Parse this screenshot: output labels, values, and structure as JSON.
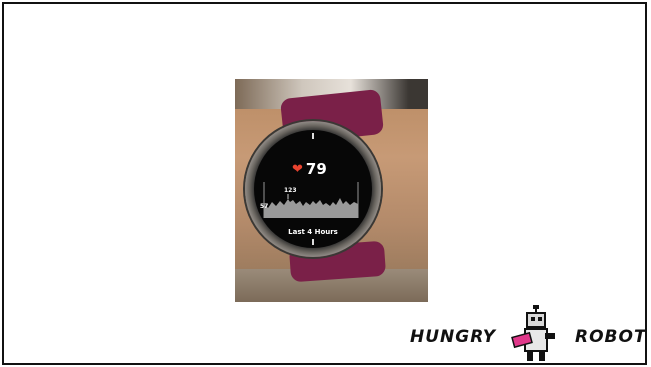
{
  "watch": {
    "heart_rate": "79",
    "chart_max": "123",
    "chart_min": "57",
    "caption": "Last 4 Hours",
    "icon": "heart-icon"
  },
  "logo": {
    "left_word": "HUNGRY",
    "right_word": "ROBOT",
    "icon": "robot-icon"
  },
  "colors": {
    "strap": "#7a2048",
    "heart": "#e8432f",
    "logo_accent": "#e0388a"
  }
}
